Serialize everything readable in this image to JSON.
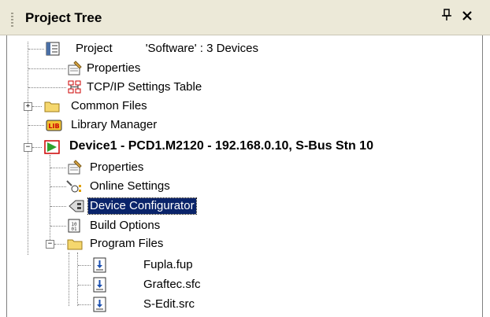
{
  "panel": {
    "title": "Project Tree",
    "pin_glyph": "↕",
    "close_glyph": "✕"
  },
  "tree": {
    "items": [
      {
        "label": "Project",
        "detail": "'Software' : 3 Devices",
        "icon": "project-icon"
      },
      {
        "label": "Properties",
        "icon": "properties-icon"
      },
      {
        "label": "TCP/IP Settings Table",
        "icon": "network-table-icon"
      },
      {
        "label": "Common Files",
        "icon": "folder-icon",
        "expander": "+"
      },
      {
        "label": "Library Manager",
        "icon": "lib-icon",
        "icon_text": "LIB"
      },
      {
        "label": "Device1 - PCD1.M2120 - 192.168.0.10, S-Bus Stn 10",
        "icon": "device-play-icon",
        "expander": "−"
      },
      {
        "label": "Properties",
        "icon": "properties-icon"
      },
      {
        "label": "Online Settings",
        "icon": "online-settings-icon"
      },
      {
        "label": "Device Configurator",
        "icon": "configurator-icon",
        "selected": true
      },
      {
        "label": "Build Options",
        "icon": "build-options-icon"
      },
      {
        "label": "Program Files",
        "icon": "folder-icon",
        "expander": "−"
      },
      {
        "label": "Fupla.fup",
        "icon": "file-download-icon"
      },
      {
        "label": "Graftec.sfc",
        "icon": "file-download-icon"
      },
      {
        "label": "S-Edit.src",
        "icon": "file-download-icon"
      }
    ]
  },
  "colors": {
    "selection": "#0a246a",
    "titlebar": "#ece9d8",
    "folder": "#f5d76e",
    "play": "#2ea12e"
  }
}
